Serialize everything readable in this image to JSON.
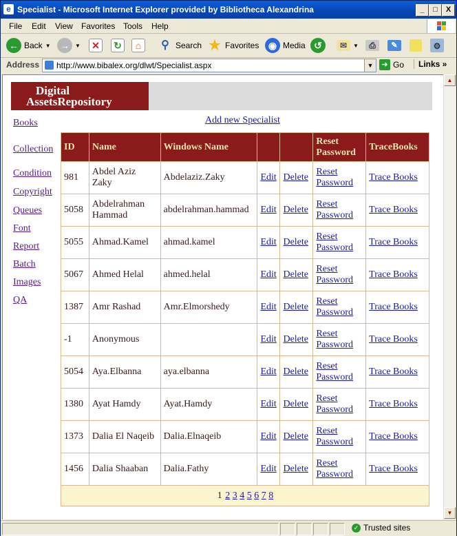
{
  "window": {
    "title": "Specialist - Microsoft Internet Explorer provided by Bibliotheca Alexandrina",
    "minimize": "_",
    "maximize": "□",
    "close": "X"
  },
  "menu": [
    "File",
    "Edit",
    "View",
    "Favorites",
    "Tools",
    "Help"
  ],
  "toolbar": {
    "back": "Back",
    "search": "Search",
    "favorites": "Favorites",
    "media": "Media"
  },
  "address": {
    "label": "Address",
    "url": "http://www.bibalex.org/dlwt/Specialist.aspx",
    "go": "Go",
    "links": "Links"
  },
  "logo": {
    "line1": "Digital",
    "line2": "AssetsRepository"
  },
  "nav": [
    "Books",
    "Collection",
    "Condition",
    "Copyright",
    "Queues",
    "Font",
    "Report",
    "Batch",
    "Images",
    "QA"
  ],
  "add_new": "Add new Specialist",
  "table": {
    "headers": [
      "ID",
      "Name",
      "Windows Name",
      "",
      "",
      "Reset Password",
      "TraceBooks"
    ],
    "edit_label": "Edit",
    "delete_label": "Delete",
    "reset_label": "Reset Password",
    "trace_label": "Trace Books",
    "rows": [
      {
        "id": "981",
        "name": "Abdel Aziz Zaky",
        "windows_name": "Abdelaziz.Zaky"
      },
      {
        "id": "5058",
        "name": "Abdelrahman Hammad",
        "windows_name": "abdelrahman.hammad"
      },
      {
        "id": "5055",
        "name": "Ahmad.Kamel",
        "windows_name": "ahmad.kamel"
      },
      {
        "id": "5067",
        "name": "Ahmed Helal",
        "windows_name": "ahmed.helal"
      },
      {
        "id": "1387",
        "name": "Amr Rashad",
        "windows_name": "Amr.Elmorshedy"
      },
      {
        "id": "-1",
        "name": "Anonymous",
        "windows_name": ""
      },
      {
        "id": "5054",
        "name": "Aya.Elbanna",
        "windows_name": "aya.elbanna"
      },
      {
        "id": "1380",
        "name": "Ayat Hamdy",
        "windows_name": "Ayat.Hamdy"
      },
      {
        "id": "1373",
        "name": "Dalia El Naqeib",
        "windows_name": "Dalia.Elnaqeib"
      },
      {
        "id": "1456",
        "name": "Dalia Shaaban",
        "windows_name": "Dalia.Fathy"
      }
    ],
    "pager": {
      "current": "1",
      "pages": [
        "2",
        "3",
        "4",
        "5",
        "6",
        "7",
        "8"
      ]
    }
  },
  "status": {
    "zone": "Trusted sites"
  },
  "colors": {
    "header_bg": "#8b1a1a",
    "header_text": "#f2e2b0",
    "pager_bg": "#fbf5cf",
    "link": "#1a1aa6"
  }
}
